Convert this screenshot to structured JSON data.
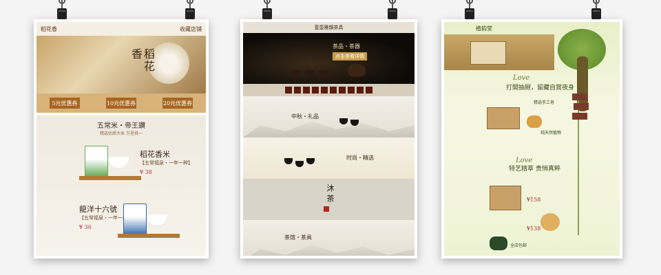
{
  "posters": {
    "rice": {
      "header_left": "稻花香",
      "header_right": "收藏店铺",
      "hero_title_a": "稻花",
      "hero_title_b": "香",
      "coupons": [
        "5元优惠券",
        "10元优惠券",
        "20元优惠券"
      ],
      "section_title": "五常米・帝王鑽",
      "section_sub": "精选优质大米 万里挑一",
      "product1": {
        "name": "稻花香米",
        "desc": "【五常福泉・一年一种】",
        "price": "¥ 38"
      },
      "product2": {
        "name": "龍洋十六號",
        "desc": "【五常福泉・一年一种】",
        "price": "¥ 36"
      }
    },
    "tea": {
      "header": "壹壺雅韻茶具",
      "hero_tag": "茶品・茶器",
      "hero_badge": "点击查看详情",
      "band1_label": "中秋・礼品",
      "band2_label": "时尚・精选",
      "band3_vertical": "沐茶",
      "band4_label": "茶馆・茶具"
    },
    "soap": {
      "header": "植韵堂",
      "slogan1": "打開抽屜，留藏自賞夜身",
      "script1": "Love",
      "slogan2": "特艺精萃 贵悄真粹",
      "script2": "Love",
      "price1": "¥158",
      "price2": "¥138",
      "note1": "精选手工皂",
      "note2": "纯天然植物",
      "note3": "全店包邮"
    }
  },
  "icons": {
    "clip": "binder-clip-icon"
  },
  "colors": {
    "background": "#f4f4f4",
    "rice_accent": "#a8651f",
    "tea_dark": "#0d0a07",
    "soap_green": "#8ab04a"
  }
}
